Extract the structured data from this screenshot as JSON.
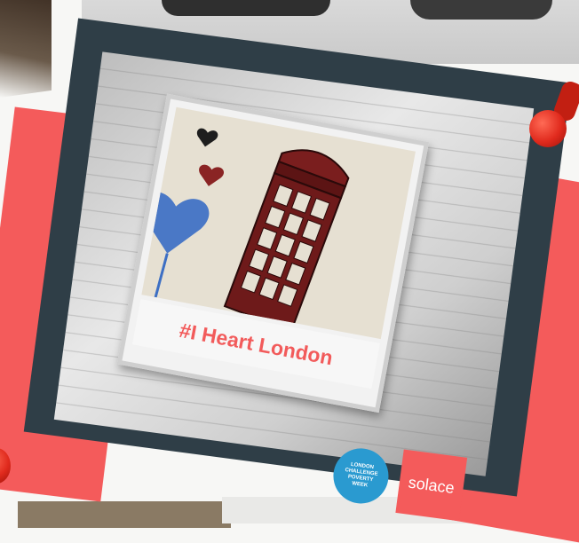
{
  "poster": {
    "caption": "#I Heart London",
    "badge_challenge_lines": [
      "LONDON",
      "CHALLENGE",
      "POVERTY",
      "WEEK"
    ],
    "badge_brand": "solace"
  },
  "colors": {
    "accent_coral": "#f45b5b",
    "card_dark": "#2f3e47",
    "badge_blue": "#2a9ad0",
    "heart_blue": "#3d6fc4",
    "booth_red": "#7a1e1e"
  },
  "icons": [
    "push-pin-icon",
    "heart-icon",
    "phone-box-illustration"
  ]
}
